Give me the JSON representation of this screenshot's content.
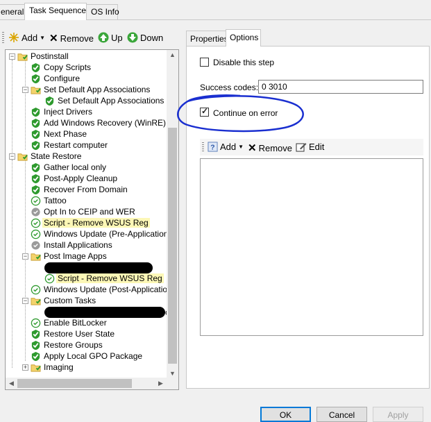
{
  "tabs": [
    "eneral",
    "Task Sequence",
    "OS Info"
  ],
  "toolbar": {
    "add": "Add",
    "remove": "Remove",
    "up": "Up",
    "down": "Down"
  },
  "tree": {
    "groups": {
      "postinstall": "Postinstall",
      "state_restore": "State Restore",
      "post_image_apps": "Post Image Apps",
      "custom_tasks": "Custom Tasks",
      "imaging": "Imaging"
    },
    "items": {
      "copy_scripts": "Copy Scripts",
      "configure": "Configure",
      "set_default_app_assoc_group": "Set Default App Associations",
      "set_default_app_assoc": "Set Default App Associations",
      "inject_drivers": "Inject Drivers",
      "add_winre": "Add Windows Recovery (WinRE)",
      "next_phase": "Next Phase",
      "restart_computer": "Restart computer",
      "gather_local_only": "Gather local only",
      "post_apply_cleanup": "Post-Apply Cleanup",
      "recover_from_domain": "Recover From Domain",
      "tattoo": "Tattoo",
      "opt_in_ceip": "Opt In to CEIP and WER",
      "script_remove_wsus_1": "Script - Remove WSUS Reg",
      "windows_update_pre": "Windows Update (Pre-Application Inst",
      "install_applications": "Install Applications",
      "script_remove_wsus_2": "Script - Remove WSUS Reg",
      "windows_update_post": "Windows Update (Post-Application Ins",
      "custom_tail": "c",
      "enable_bitlocker": "Enable BitLocker",
      "restore_user_state": "Restore User State",
      "restore_groups": "Restore Groups",
      "apply_local_gpo": "Apply Local GPO Package"
    }
  },
  "right": {
    "tabs": [
      "Properties",
      "Options"
    ],
    "disable_label": "Disable this step",
    "success_codes_label": "Success codes:",
    "success_codes_value": "0 3010",
    "continue_label": "Continue on error",
    "toolbar": {
      "add": "Add",
      "remove": "Remove",
      "edit": "Edit"
    }
  },
  "buttons": {
    "ok": "OK",
    "cancel": "Cancel",
    "apply": "Apply"
  },
  "colors": {
    "annotation": "#1a2fd0",
    "highlight": "#fcf7b6",
    "status_green": "#2e9a2e"
  }
}
